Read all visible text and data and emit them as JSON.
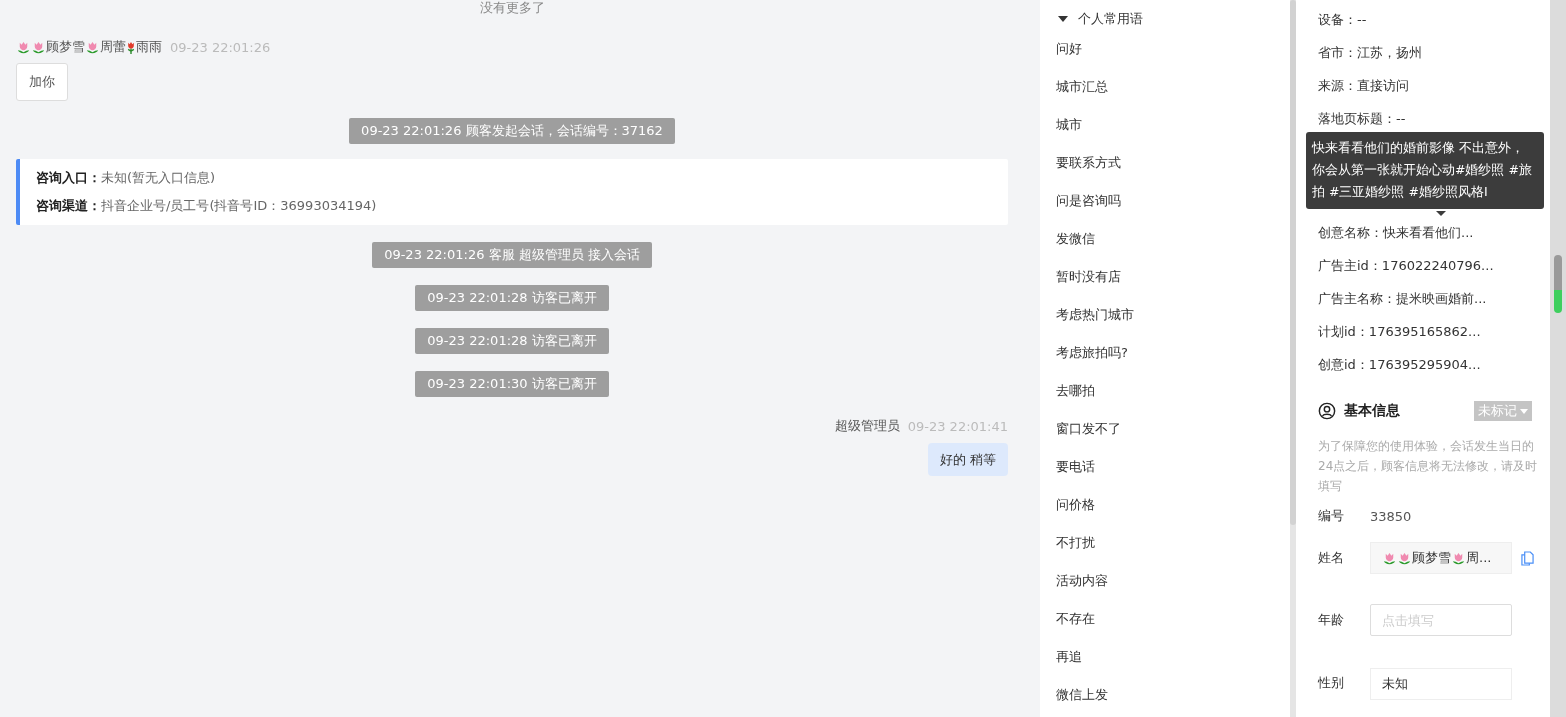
{
  "chat": {
    "no_more": "没有更多了",
    "messages": [
      {
        "kind": "customer",
        "name_parts": [
          {
            "kind": "tulip"
          },
          {
            "kind": "tulip"
          },
          {
            "kind": "text",
            "text": "顾梦雪"
          },
          {
            "kind": "tulip"
          },
          {
            "kind": "text",
            "text": "周蕾"
          },
          {
            "kind": "rosebud"
          },
          {
            "kind": "text",
            "text": "雨雨"
          }
        ],
        "time": "09-23 22:01:26",
        "text": "加你"
      },
      {
        "kind": "system",
        "text": "09-23 22:01:26 顾客发起会话，会话编号：37162"
      },
      {
        "kind": "info",
        "rows": [
          {
            "label": "咨询入口：",
            "value": "未知(暂无入口信息)"
          },
          {
            "label": "咨询渠道：",
            "value": "抖音企业号/员工号(抖音号ID：36993034194)"
          }
        ]
      },
      {
        "kind": "system",
        "text": "09-23 22:01:26 客服 超级管理员 接入会话"
      },
      {
        "kind": "system",
        "text": "09-23 22:01:28 访客已离开"
      },
      {
        "kind": "system",
        "text": "09-23 22:01:28 访客已离开"
      },
      {
        "kind": "system",
        "text": "09-23 22:01:30 访客已离开"
      },
      {
        "kind": "agent",
        "name": "超级管理员",
        "time": "09-23 22:01:41",
        "text": "好的 稍等"
      }
    ]
  },
  "phrases": {
    "group": "个人常用语",
    "expanded": true,
    "items": [
      "问好",
      "城市汇总",
      "城市",
      "要联系方式",
      "问是咨询吗",
      "发微信",
      "暂时没有店",
      "考虑热门城市",
      "考虑旅拍吗?",
      "去哪拍",
      "窗口发不了",
      "要电话",
      "问价格",
      "不打扰",
      "活动内容",
      "不存在",
      "再追",
      "微信上发"
    ]
  },
  "source": {
    "rows_top": [
      "设备：--",
      "省市：江苏，扬州",
      "来源：直接访问",
      "落地页标题：--"
    ],
    "tooltip": [
      "快来看看他们的婚前影像 不出意外，",
      "你会从第一张就开始心动#婚纱照 #旅",
      "拍 #三亚婚纱照 #婚纱照风格I"
    ],
    "rows_bottom": [
      "创意名称：快来看看他们...",
      "广告主id：176022240796...",
      "广告主名称：提米映画婚前...",
      "计划id：176395165862...",
      "创意id：176395295904..."
    ]
  },
  "basic": {
    "title": "基本信息",
    "tag": "未标记",
    "notice": "为了保障您的使用体验，会话发生当日的24点之后，顾客信息将无法修改，请及时填写",
    "id_label": "编号",
    "id_value": "33850",
    "name_label": "姓名",
    "name_parts": [
      {
        "kind": "tulip"
      },
      {
        "kind": "tulip"
      },
      {
        "kind": "text",
        "text": "顾梦雪"
      },
      {
        "kind": "tulip"
      },
      {
        "kind": "text",
        "text": "周..."
      }
    ],
    "age_label": "年龄",
    "age_placeholder": "点击填写",
    "gender_label": "性别",
    "gender_value": "未知"
  }
}
